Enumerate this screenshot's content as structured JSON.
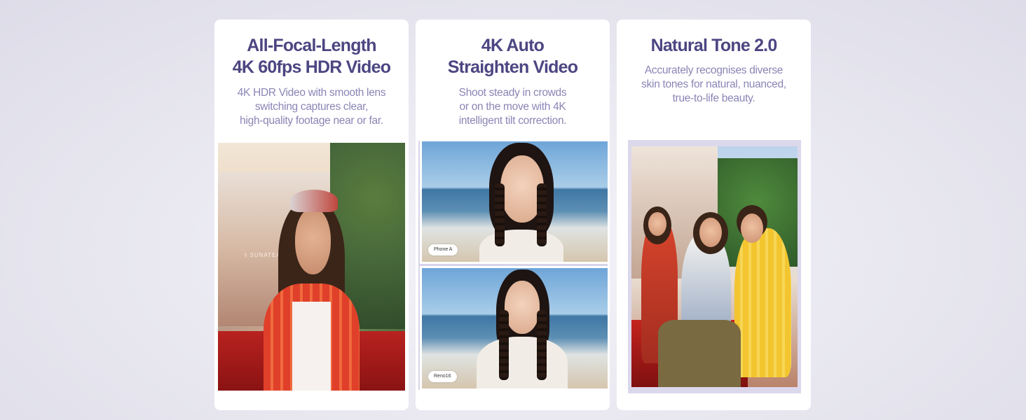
{
  "cards": [
    {
      "title_line1": "All-Focal-Length",
      "title_line2": "4K 60fps HDR Video",
      "desc_line1": "4K HDR Video with smooth lens",
      "desc_line2": "switching captures clear,",
      "desc_line3": "high-quality footage near or far.",
      "photo_sign": "◊ SUNATEA"
    },
    {
      "title_line1": "4K Auto",
      "title_line2": "Straighten Video",
      "desc_line1": "Shoot steady in crowds",
      "desc_line2": "or on the move with 4K",
      "desc_line3": "intelligent tilt correction.",
      "tag_top": "Phone A",
      "tag_bottom": "Reno16"
    },
    {
      "title_line1": "Natural Tone 2.0",
      "desc_line1": "Accurately recognises diverse",
      "desc_line2": "skin tones for natural, nuanced,",
      "desc_line3": "true-to-life beauty."
    }
  ],
  "colors": {
    "title": "#4c4682",
    "description": "#8a85b5",
    "card_bg": "#ffffff"
  }
}
